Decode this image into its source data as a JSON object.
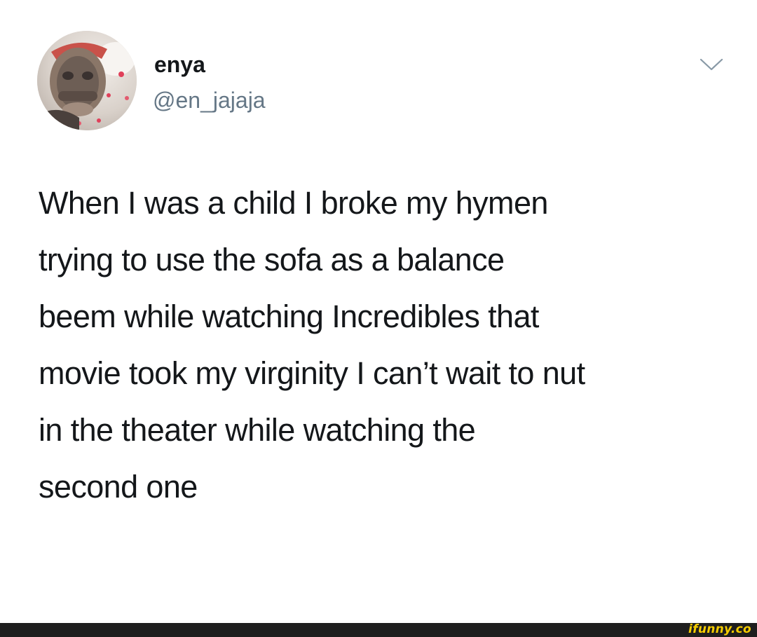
{
  "tweet": {
    "display_name": "enya",
    "handle": "@en_jajaja",
    "text_lines": [
      "When I was a child I broke my hymen",
      "trying to use the sofa as a balance",
      "beem while watching Incredibles that",
      "movie took my virginity I can’t wait to nut",
      "in the theater while watching the",
      "second one"
    ],
    "avatar_icon": "profile-photo",
    "menu_icon": "chevron-down-icon"
  },
  "footer": {
    "watermark": "ifunny.co"
  },
  "colors": {
    "background": "#ffffff",
    "text": "#14171a",
    "secondary_text": "#657786",
    "footer_bar": "#1e1e1e",
    "watermark": "#f5cc00"
  }
}
